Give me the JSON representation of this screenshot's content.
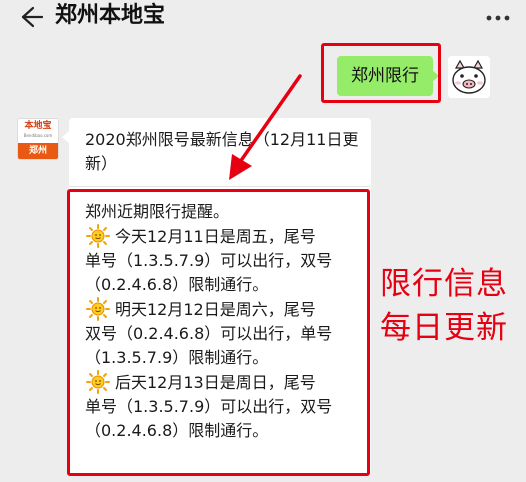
{
  "header": {
    "title": "郑州本地宝",
    "back_icon": "back-arrow-icon",
    "more_icon": "more-dots-icon"
  },
  "my_message": {
    "text": "郑州限行"
  },
  "sender": {
    "avatar_logo_text": "本地宝",
    "avatar_domain_text": "Bendibao.com",
    "avatar_city_text": "郑州"
  },
  "reply": {
    "title": "2020郑州限号最新信息（12月11日更新）",
    "intro": "郑州近期限行提醒。",
    "items": [
      {
        "icon": "sun-icon",
        "line1": "今天12月11日是周五，尾号",
        "line2": "单号（1.3.5.7.9）可以出行，双号",
        "line3": "（0.2.4.6.8）限制通行。"
      },
      {
        "icon": "sun-icon",
        "line1": "明天12月12日是周六，尾号",
        "line2": "双号（0.2.4.6.8）可以出行，单号",
        "line3": "（1.3.5.7.9）限制通行。"
      },
      {
        "icon": "sun-icon",
        "line1": "后天12月13日是周日，尾号",
        "line2": "单号（1.3.5.7.9）可以出行，双号",
        "line3": "（0.2.4.6.8）限制通行。"
      }
    ]
  },
  "annotation": {
    "line1": "限行信息",
    "line2": "每日更新",
    "color": "#e60012"
  },
  "colors": {
    "background": "#ededed",
    "my_bubble": "#95ec69",
    "reply_bubble": "#ffffff",
    "brand_orange": "#e85a13"
  }
}
